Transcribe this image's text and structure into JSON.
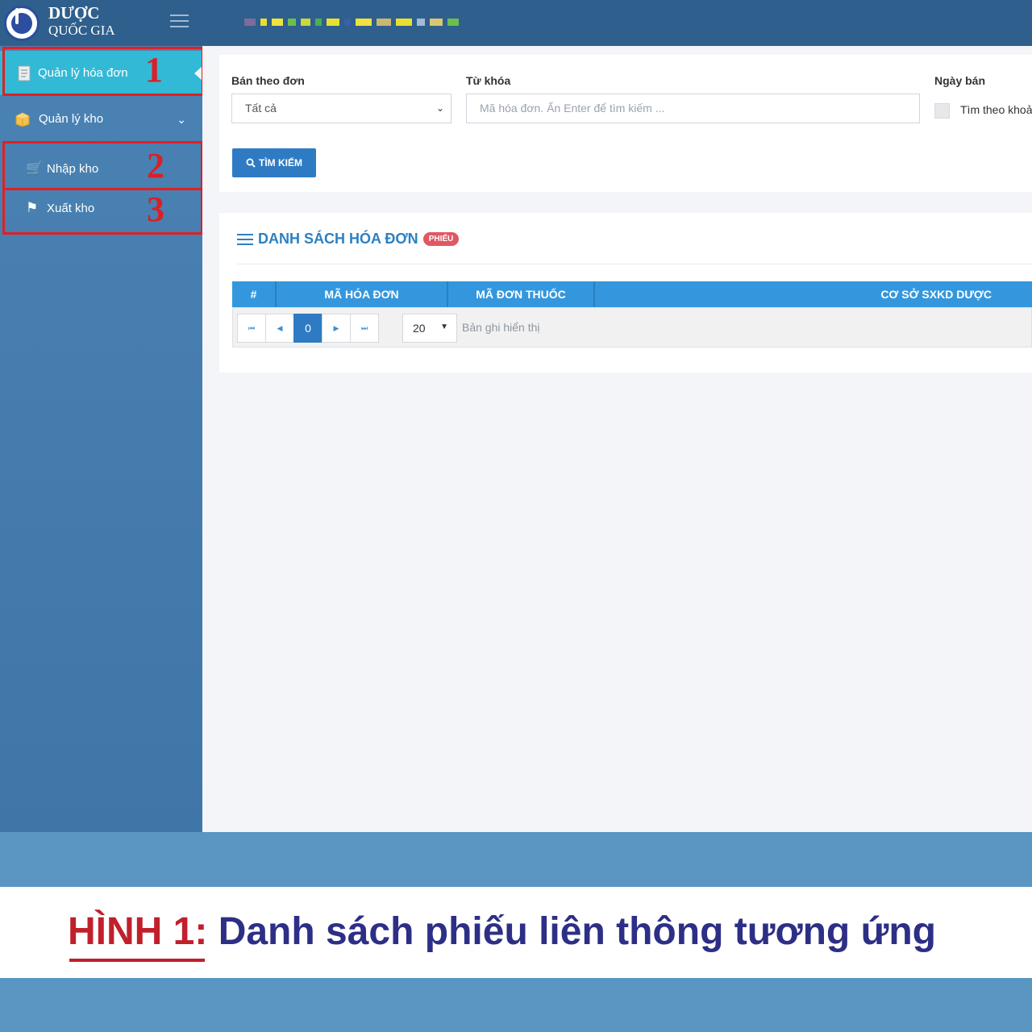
{
  "header": {
    "brand_line1": "DƯỢC",
    "brand_line2": "QUỐC GIA"
  },
  "sidebar": {
    "items": [
      {
        "label": "Quản lý hóa đơn",
        "icon": "invoice-icon",
        "active": true,
        "marker": "1"
      },
      {
        "label": "Quản lý kho",
        "icon": "box-icon",
        "chevron": "⌄"
      },
      {
        "label": "Nhập kho",
        "icon": "cart-icon",
        "marker": "2"
      },
      {
        "label": "Xuất kho",
        "icon": "signpost-icon",
        "marker": "3"
      }
    ]
  },
  "filters": {
    "sale_label": "Bán theo đơn",
    "sale_value": "Tất cả",
    "keyword_label": "Từ khóa",
    "keyword_placeholder": "Mã hóa đơn. Ấn Enter để tìm kiếm ...",
    "date_label": "Ngày bán",
    "date_checkbox_label": "Tìm theo khoả",
    "search_button": "TÌM KIẾM"
  },
  "list": {
    "title": "DANH SÁCH HÓA ĐƠN",
    "badge": "PHIẾU",
    "columns": [
      "#",
      "MÃ HÓA ĐƠN",
      "MÃ ĐƠN THUỐC",
      "CƠ SỞ SXKD DƯỢC"
    ],
    "pager": {
      "first": "⏮",
      "prev": "◀",
      "current": "0",
      "next": "▶",
      "last": "⏭"
    },
    "page_size": "20",
    "records_label": "Bản ghi hiển thị"
  },
  "caption": {
    "prefix": "HÌNH 1:",
    "text": "Danh sách phiếu liên thông tương ứng"
  },
  "colors": {
    "header_bg": "#2f5f8c",
    "sidebar_bg": "#4a82b3",
    "active_item": "#32b9d6",
    "primary": "#2e7bc4",
    "marker_red": "#e02024"
  }
}
